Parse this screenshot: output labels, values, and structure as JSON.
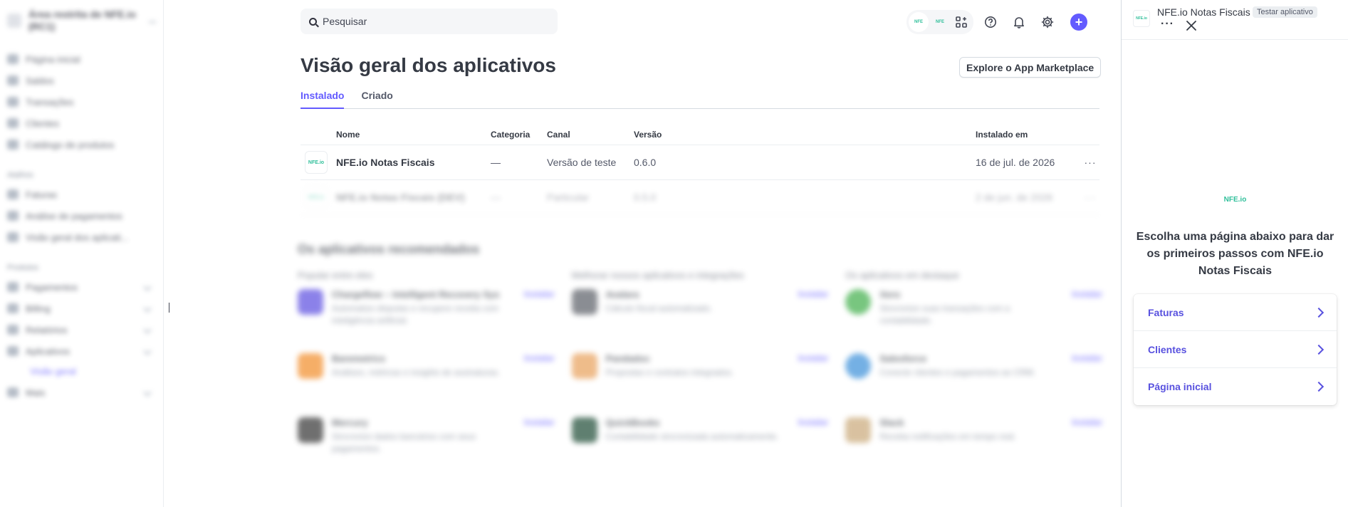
{
  "sidebar": {
    "account_name": "Área restrita de NFE.io (RC1)",
    "items": [
      {
        "label": "Página inicial"
      },
      {
        "label": "Saldos"
      },
      {
        "label": "Transações"
      },
      {
        "label": "Clientes"
      },
      {
        "label": "Catálogo de produtos"
      }
    ],
    "shortcuts_heading": "Atalhos",
    "shortcuts": [
      {
        "label": "Faturas"
      },
      {
        "label": "Análise de pagamentos"
      },
      {
        "label": "Visão geral dos aplicati..."
      }
    ],
    "products_heading": "Produtos",
    "products": [
      {
        "label": "Pagamentos"
      },
      {
        "label": "Billing"
      },
      {
        "label": "Relatórios"
      },
      {
        "label": "Aplicativos"
      }
    ],
    "active_sub": "Visão geral",
    "more_label": "Mais"
  },
  "search": {
    "placeholder": "Pesquisar"
  },
  "topbar": {
    "app_icons": [
      "NFE",
      "NFE"
    ],
    "icons": [
      "apps-grid-icon",
      "help-icon",
      "bell-icon",
      "gear-icon",
      "plus-icon"
    ],
    "accent": "#635bff"
  },
  "page": {
    "title": "Visão geral dos aplicativos",
    "explore_button": "Explore o App Marketplace",
    "tabs": [
      {
        "label": "Instalado",
        "active": true
      },
      {
        "label": "Criado",
        "active": false
      }
    ]
  },
  "table": {
    "columns": [
      "Nome",
      "Categoria",
      "Canal",
      "Versão",
      "Instalado em"
    ],
    "rows": [
      {
        "logo": "NFE.io",
        "name": "NFE.io Notas Fiscais",
        "category": "—",
        "channel": "Versão de teste",
        "version": "0.6.0",
        "installed": "16 de jul. de 2026"
      },
      {
        "logo": "NFE.io",
        "name": "NFE.io Notas Fiscais (DEV)",
        "category": "—",
        "channel": "Particular",
        "version": "0.5.0",
        "installed": "2 de jun. de 2026"
      }
    ]
  },
  "recommended": {
    "heading": "Os aplicativos recomendados",
    "columns": [
      {
        "heading": "Popular entre eles",
        "apps": [
          {
            "name": "Chargeflow – Intelligent Recovery Sys",
            "desc": "Automatize disputas e recupere receita com inteligência artificial.",
            "action": "Instalar",
            "color": "#5b4de0"
          },
          {
            "name": "Baremetrics",
            "desc": "Análises, métricas e insights de assinaturas.",
            "action": "Instalar",
            "color": "#f28c28"
          },
          {
            "name": "Mercury",
            "desc": "Sincronize dados bancários com seus pagamentos.",
            "action": "Instalar",
            "color": "#333333"
          }
        ]
      },
      {
        "heading": "Melhorar nossos aplicativos e integrações",
        "apps": [
          {
            "name": "Avalara",
            "desc": "Cálculo fiscal automatizado.",
            "action": "Instalar",
            "color": "#5a5e66"
          },
          {
            "name": "Pandadoc",
            "desc": "Propostas e contratos integrados.",
            "action": "Instalar",
            "color": "#e8a05a"
          },
          {
            "name": "QuickBooks",
            "desc": "Contabilidade sincronizada automaticamente.",
            "action": "Instalar",
            "color": "#1c4a34"
          }
        ]
      },
      {
        "heading": "Os aplicativos em destaque",
        "apps": [
          {
            "name": "Xero",
            "desc": "Sincronize suas transações com a contabilidade.",
            "action": "Instalar",
            "color": "#3fae49"
          },
          {
            "name": "Salesforce",
            "desc": "Conecte clientes e pagamentos ao CRM.",
            "action": "Instalar",
            "color": "#3a8fd9"
          },
          {
            "name": "Slack",
            "desc": "Receba notificações em tempo real.",
            "action": "Instalar",
            "color": "#c9a878"
          }
        ]
      }
    ]
  },
  "panel": {
    "app_name": "NFE.io Notas Fiscais",
    "badge": "Testar aplicativo",
    "logo_text": "NFE.io",
    "heading": "Escolha uma página abaixo para dar os primeiros passos com NFE.io Notas Fiscais",
    "links": [
      {
        "label": "Faturas"
      },
      {
        "label": "Clientes"
      },
      {
        "label": "Página inicial"
      }
    ],
    "link_color": "#5851df"
  }
}
